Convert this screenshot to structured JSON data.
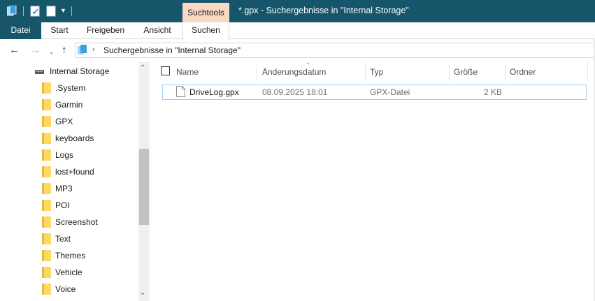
{
  "window": {
    "title": "*.gpx - Suchergebnisse in \"Internal Storage\"",
    "context_tab": "Suchtools"
  },
  "ribbon": {
    "tabs": [
      "Datei",
      "Start",
      "Freigeben",
      "Ansicht",
      "Suchen"
    ]
  },
  "address": {
    "path": "Suchergebnisse in \"Internal Storage\""
  },
  "tree": {
    "root": "Internal Storage",
    "folders": [
      ".System",
      "Garmin",
      "GPX",
      "keyboards",
      "Logs",
      "lost+found",
      "MP3",
      "POI",
      "Screenshot",
      "Text",
      "Themes",
      "Vehicle",
      "Voice"
    ]
  },
  "list": {
    "columns": {
      "name": "Name",
      "date": "Änderungsdatum",
      "type": "Typ",
      "size": "Größe",
      "folder": "Ordner"
    },
    "rows": [
      {
        "name": "DriveLog.gpx",
        "date": "08.09.2025 18:01",
        "type": "GPX-Datei",
        "size": "2 KB",
        "folder": ""
      }
    ]
  },
  "colors": {
    "titlebar": "#17566a",
    "context_tab": "#f8d9c4",
    "folder": "#ffd763",
    "selection_border": "#99d1ff"
  }
}
